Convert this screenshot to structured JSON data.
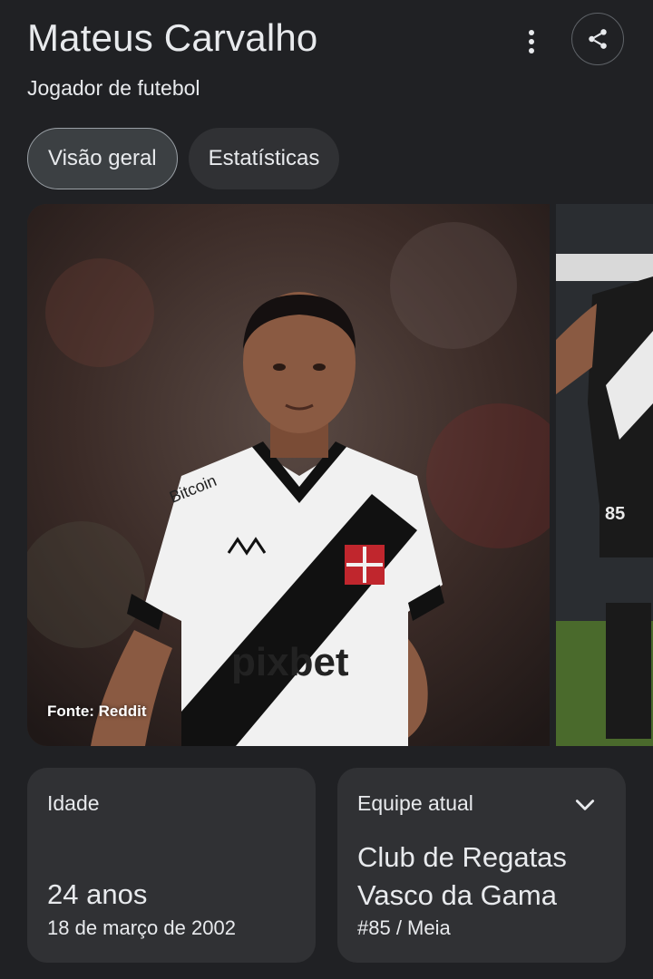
{
  "header": {
    "title": "Mateus Carvalho",
    "subtitle": "Jogador de futebol",
    "more_icon": "more-vert-icon",
    "share_icon": "share-icon"
  },
  "tabs": [
    {
      "label": "Visão geral",
      "active": true
    },
    {
      "label": "Estatísticas",
      "active": false
    }
  ],
  "photos": {
    "credit": "Fonte: Reddit",
    "shirt_texts": [
      "pixbet",
      "Bitcoin"
    ],
    "second_shirt_number": "85"
  },
  "cards": {
    "age": {
      "label": "Idade",
      "value": "24 anos",
      "detail": "18 de março de 2002"
    },
    "team": {
      "label": "Equipe atual",
      "value": "Club de Regatas Vasco da Gama",
      "detail": "#85 / Meia",
      "chevron_icon": "chevron-down-icon"
    }
  },
  "colors": {
    "background": "#202124",
    "card": "#303134",
    "text": "#e8eaed",
    "outline": "#9aa0a6"
  }
}
